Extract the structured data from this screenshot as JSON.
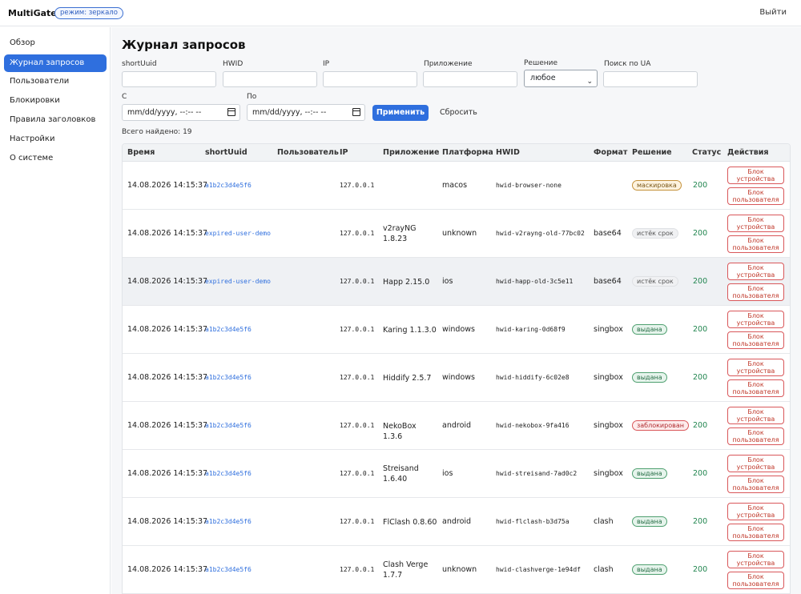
{
  "topbar": {
    "brand": "MultiGate",
    "mode": "режим: зеркало",
    "logout": "Выйти"
  },
  "sidebar": {
    "items": [
      {
        "label": "Обзор",
        "active": false
      },
      {
        "label": "Журнал запросов",
        "active": true
      },
      {
        "label": "Пользователи",
        "active": false
      },
      {
        "label": "Блокировки",
        "active": false
      },
      {
        "label": "Правила заголовков",
        "active": false
      },
      {
        "label": "Настройки",
        "active": false
      },
      {
        "label": "О системе",
        "active": false
      }
    ]
  },
  "page": {
    "title": "Журнал запросов"
  },
  "filters": {
    "shortuuid_label": "shortUuid",
    "hwid_label": "HWID",
    "ip_label": "IP",
    "app_label": "Приложение",
    "decision_label": "Решение",
    "decision_value": "любое",
    "ua_label": "Поиск по UA",
    "from_label": "С",
    "to_label": "По",
    "datetime_placeholder": "mm/dd/yyyy, --:-- --",
    "apply": "Применить",
    "reset": "Сбросить"
  },
  "summary": {
    "label": "Всего найдено:",
    "count": "19"
  },
  "table": {
    "columns": [
      "Время",
      "shortUuid",
      "Пользователь",
      "IP",
      "Приложение",
      "Платформа",
      "HWID",
      "Формат",
      "Решение",
      "Статус",
      "Действия"
    ],
    "action_device": [
      "Блок",
      "устройства"
    ],
    "action_user": [
      "Блок",
      "пользователя"
    ],
    "rows": [
      {
        "time": "14.08.2026 14:15:37",
        "shortuuid": "a1b2c3d4e5f6",
        "user": "",
        "ip": "127.0.0.1",
        "app1": "",
        "app2": "",
        "platform": "macos",
        "hwid": "hwid-browser-none",
        "format": "",
        "decision": "маскировка",
        "decision_kind": "mask",
        "status": "200"
      },
      {
        "time": "14.08.2026 14:15:37",
        "shortuuid": "expired-user-demo",
        "user": "",
        "ip": "127.0.0.1",
        "app1": "v2rayNG",
        "app2": "1.8.23",
        "platform": "unknown",
        "hwid": "hwid-v2rayng-old-77bc02",
        "format": "base64",
        "decision": "истёк срок",
        "decision_kind": "exp",
        "status": "200"
      },
      {
        "time": "14.08.2026 14:15:37",
        "shortuuid": "expired-user-demo",
        "user": "",
        "ip": "127.0.0.1",
        "app1": "Happ 2.15.0",
        "app2": "",
        "platform": "ios",
        "hwid": "hwid-happ-old-3c5e11",
        "format": "base64",
        "decision": "истёк срок",
        "decision_kind": "exp",
        "status": "200"
      },
      {
        "time": "14.08.2026 14:15:37",
        "shortuuid": "a1b2c3d4e5f6",
        "user": "",
        "ip": "127.0.0.1",
        "app1": "Karing 1.1.3.0",
        "app2": "",
        "platform": "windows",
        "hwid": "hwid-karing-0d68f9",
        "format": "singbox",
        "decision": "выдана",
        "decision_kind": "ok",
        "status": "200"
      },
      {
        "time": "14.08.2026 14:15:37",
        "shortuuid": "a1b2c3d4e5f6",
        "user": "",
        "ip": "127.0.0.1",
        "app1": "Hiddify 2.5.7",
        "app2": "",
        "platform": "windows",
        "hwid": "hwid-hiddify-6c02e8",
        "format": "singbox",
        "decision": "выдана",
        "decision_kind": "ok",
        "status": "200"
      },
      {
        "time": "14.08.2026 14:15:37",
        "shortuuid": "a1b2c3d4e5f6",
        "user": "",
        "ip": "127.0.0.1",
        "app1": "NekoBox 1.3.6",
        "app2": "",
        "platform": "android",
        "hwid": "hwid-nekobox-9fa416",
        "format": "singbox",
        "decision": "заблокирован",
        "decision_kind": "block",
        "status": "200"
      },
      {
        "time": "14.08.2026 14:15:37",
        "shortuuid": "a1b2c3d4e5f6",
        "user": "",
        "ip": "127.0.0.1",
        "app1": "Streisand",
        "app2": "1.6.40",
        "platform": "ios",
        "hwid": "hwid-streisand-7ad0c2",
        "format": "singbox",
        "decision": "выдана",
        "decision_kind": "ok",
        "status": "200"
      },
      {
        "time": "14.08.2026 14:15:37",
        "shortuuid": "a1b2c3d4e5f6",
        "user": "",
        "ip": "127.0.0.1",
        "app1": "FlClash 0.8.60",
        "app2": "",
        "platform": "android",
        "hwid": "hwid-flclash-b3d75a",
        "format": "clash",
        "decision": "выдана",
        "decision_kind": "ok",
        "status": "200"
      },
      {
        "time": "14.08.2026 14:15:37",
        "shortuuid": "a1b2c3d4e5f6",
        "user": "",
        "ip": "127.0.0.1",
        "app1": "Clash Verge",
        "app2": "1.7.7",
        "platform": "unknown",
        "hwid": "hwid-clashverge-1e94df",
        "format": "clash",
        "decision": "выдана",
        "decision_kind": "ok",
        "status": "200"
      }
    ]
  },
  "colors": {
    "accent": "#2f6fde",
    "status_ok": "#21854f",
    "danger": "#d9575a"
  }
}
